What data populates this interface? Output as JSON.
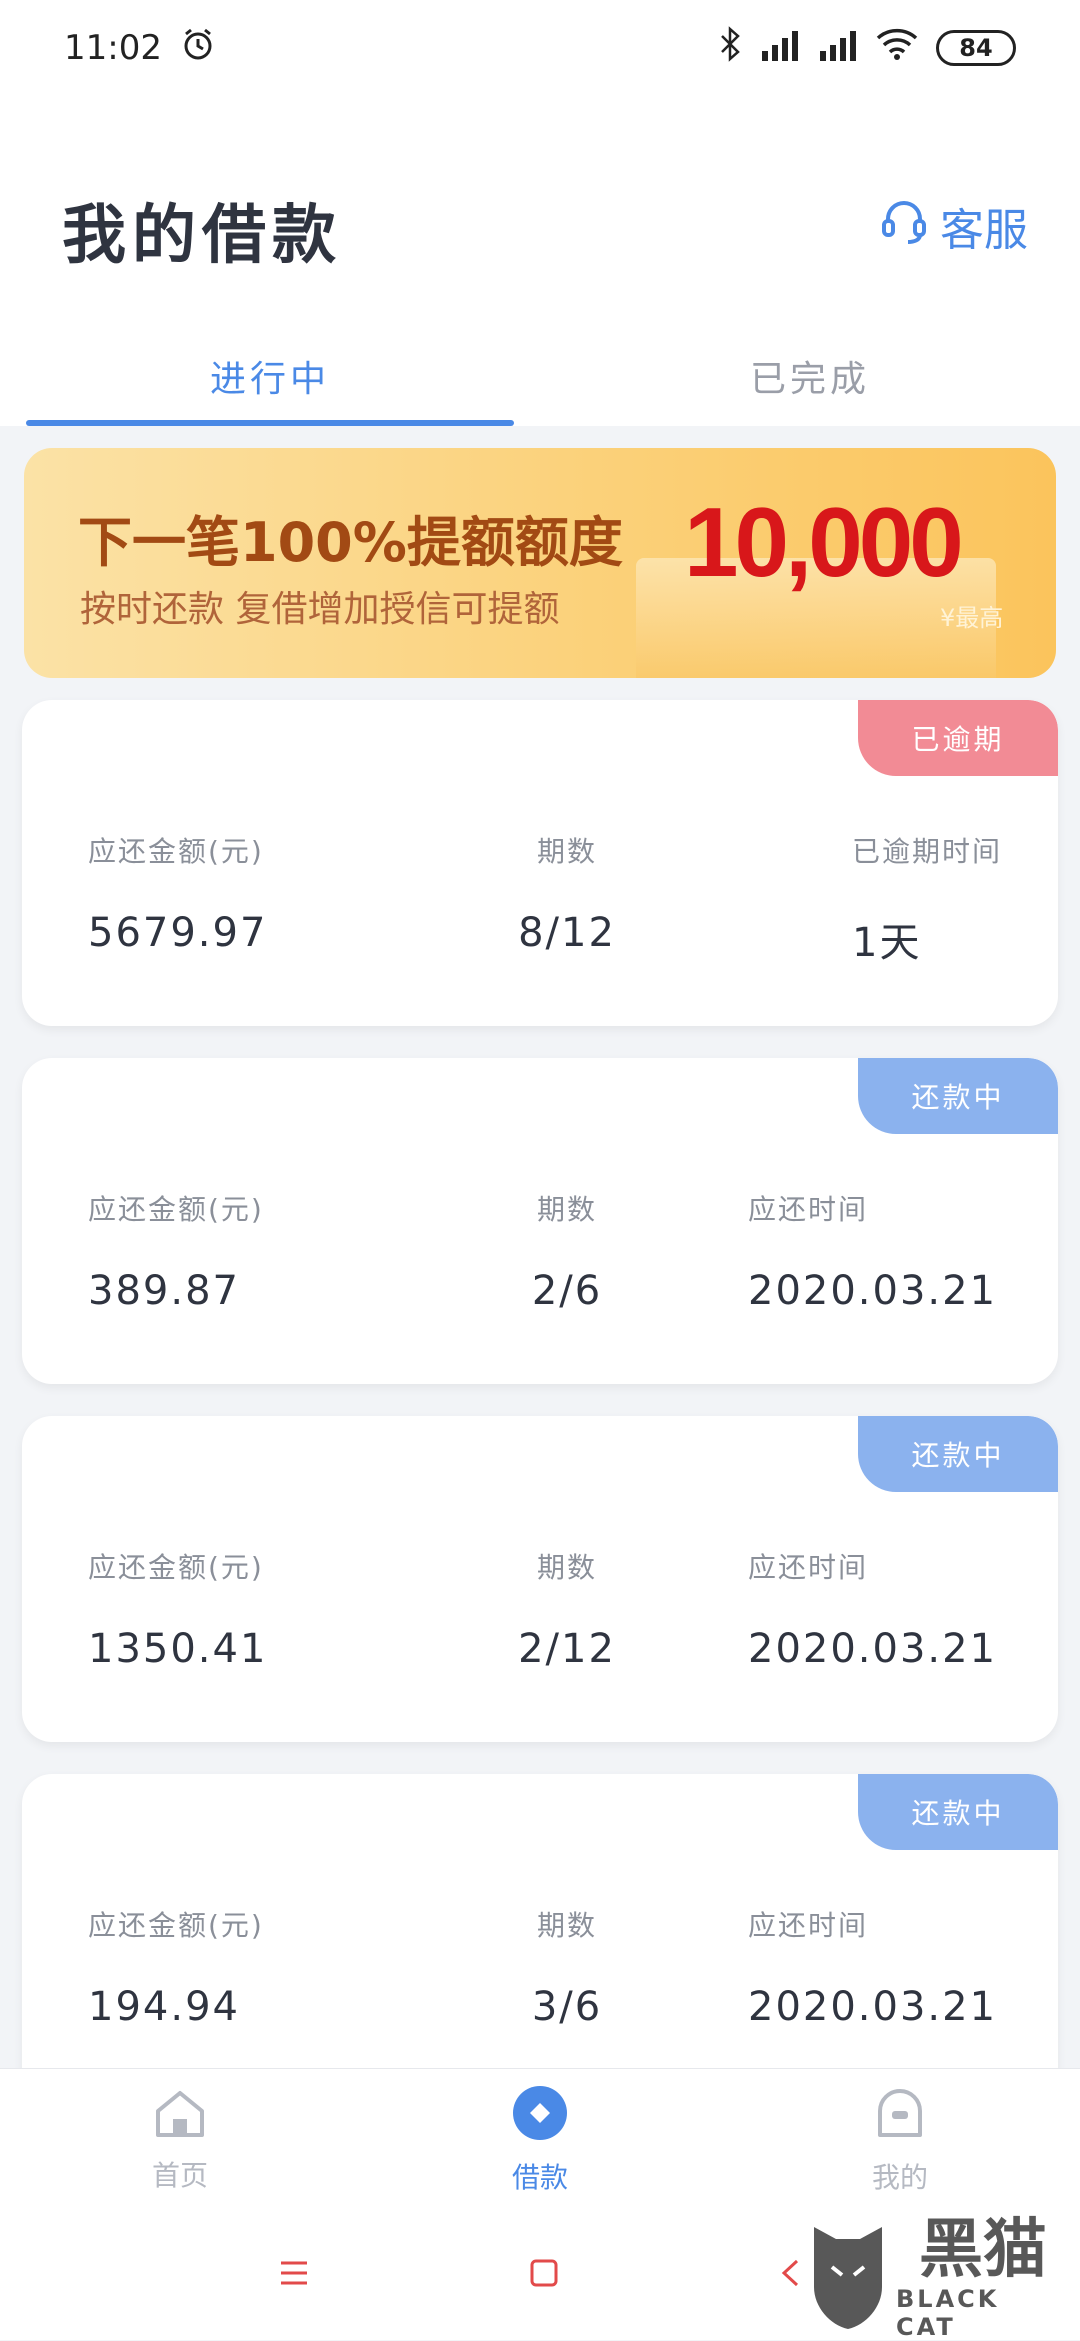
{
  "status_bar": {
    "time": "11:02",
    "battery": "84"
  },
  "header": {
    "title": "我的借款",
    "service_label": "客服"
  },
  "tabs": [
    {
      "label": "进行中",
      "active": true
    },
    {
      "label": "已完成",
      "active": false
    }
  ],
  "banner": {
    "line1": "下一笔100%提额额度",
    "line2": "按时还款  复借增加授信可提额",
    "amount": "10,000",
    "tag": "¥最高"
  },
  "loans": [
    {
      "status": "已逾期",
      "amount_label": "应还金额(元)",
      "amount": "5679.97",
      "period_label": "期数",
      "period": "8/12",
      "third_label": "已逾期时间",
      "third_value": "1天"
    },
    {
      "status": "还款中",
      "amount_label": "应还金额(元)",
      "amount": "389.87",
      "period_label": "期数",
      "period": "2/6",
      "third_label": "应还时间",
      "third_value": "2020.03.21"
    },
    {
      "status": "还款中",
      "amount_label": "应还金额(元)",
      "amount": "1350.41",
      "period_label": "期数",
      "period": "2/12",
      "third_label": "应还时间",
      "third_value": "2020.03.21"
    },
    {
      "status": "还款中",
      "amount_label": "应还金额(元)",
      "amount": "194.94",
      "period_label": "期数",
      "period": "3/6",
      "third_label": "应还时间",
      "third_value": "2020.03.21"
    }
  ],
  "bottom_nav": [
    {
      "label": "首页",
      "icon": "home-icon",
      "active": false
    },
    {
      "label": "借款",
      "icon": "loan-icon",
      "active": true
    },
    {
      "label": "我的",
      "icon": "profile-icon",
      "active": false
    }
  ],
  "watermark": {
    "cn": "黑猫",
    "en": "BLACK CAT"
  },
  "colors": {
    "accent": "#4a89e6",
    "overdue": "#f28b95",
    "repaying": "#8bb2ee",
    "banner_amount": "#d8171a"
  }
}
